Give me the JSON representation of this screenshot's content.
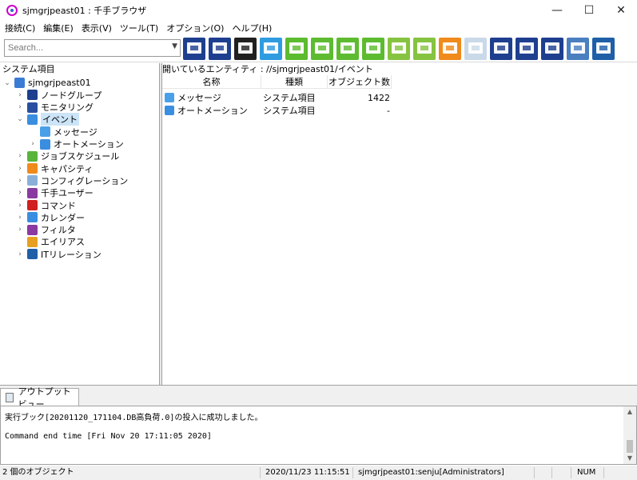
{
  "window": {
    "title": "sjmgrjpeast01 : 千手ブラウザ",
    "minimize": "—",
    "maximize": "☐",
    "close": "✕"
  },
  "menu": [
    "接続(C)",
    "編集(E)",
    "表示(V)",
    "ツール(T)",
    "オプション(O)",
    "ヘルプ(H)"
  ],
  "toolbar": {
    "search_placeholder": "Search...",
    "icons": [
      {
        "name": "connect-tree-icon",
        "color": "#1e3f8f"
      },
      {
        "name": "monitor-window-icon",
        "color": "#1e3f8f"
      },
      {
        "name": "monitor-dark-icon",
        "color": "#202020"
      },
      {
        "name": "message-list-icon",
        "color": "#2f9be0"
      },
      {
        "name": "gear-green-icon",
        "color": "#5dbb2f"
      },
      {
        "name": "gear-green2-icon",
        "color": "#5dbb2f"
      },
      {
        "name": "gear-green3-icon",
        "color": "#5dbb2f"
      },
      {
        "name": "check-monitor-icon",
        "color": "#5dbb2f"
      },
      {
        "name": "bar-chart-icon",
        "color": "#86c340"
      },
      {
        "name": "list-chart-icon",
        "color": "#86c340"
      },
      {
        "name": "orange-chart-icon",
        "color": "#f08a1c"
      },
      {
        "name": "puzzle-icon",
        "color": "#c9d9e8"
      },
      {
        "name": "export-blue-icon",
        "color": "#1e3f8f"
      },
      {
        "name": "import-blue-icon",
        "color": "#1e3f8f"
      },
      {
        "name": "transfer-blue-icon",
        "color": "#1e3f8f"
      },
      {
        "name": "log-icon",
        "color": "#4a7fc0"
      },
      {
        "name": "radar-icon",
        "color": "#1e5fa8"
      }
    ]
  },
  "left_panel": {
    "header": "システム項目",
    "tree": [
      {
        "label": "sjmgrjpeast01",
        "level": 0,
        "twisty": "⌄",
        "icon": "globe-icon",
        "color": "#3a7bd5",
        "selected": false
      },
      {
        "label": "ノードグループ",
        "level": 1,
        "twisty": "›",
        "icon": "node-group-icon",
        "color": "#1e3f8f",
        "selected": false
      },
      {
        "label": "モニタリング",
        "level": 1,
        "twisty": "›",
        "icon": "monitoring-icon",
        "color": "#2a4fa0",
        "selected": false
      },
      {
        "label": "イベント",
        "level": 1,
        "twisty": "⌄",
        "icon": "event-icon",
        "color": "#3a8ee0",
        "selected": true
      },
      {
        "label": "メッセージ",
        "level": 2,
        "twisty": "",
        "icon": "message-icon",
        "color": "#4aa0e8",
        "selected": false
      },
      {
        "label": "オートメーション",
        "level": 2,
        "twisty": "›",
        "icon": "automation-icon",
        "color": "#3a8ee0",
        "selected": false
      },
      {
        "label": "ジョブスケジュール",
        "level": 1,
        "twisty": "›",
        "icon": "job-schedule-icon",
        "color": "#58b43a",
        "selected": false
      },
      {
        "label": "キャパシティ",
        "level": 1,
        "twisty": "›",
        "icon": "capacity-icon",
        "color": "#f08a1c",
        "selected": false
      },
      {
        "label": "コンフィグレーション",
        "level": 1,
        "twisty": "›",
        "icon": "configuration-icon",
        "color": "#8ab0d8",
        "selected": false
      },
      {
        "label": "千手ユーザー",
        "level": 1,
        "twisty": "›",
        "icon": "user-icon",
        "color": "#8a3aa0",
        "selected": false
      },
      {
        "label": "コマンド",
        "level": 1,
        "twisty": "›",
        "icon": "command-icon",
        "color": "#d02020",
        "selected": false
      },
      {
        "label": "カレンダー",
        "level": 1,
        "twisty": "›",
        "icon": "calendar-icon",
        "color": "#3a8ee0",
        "selected": false
      },
      {
        "label": "フィルタ",
        "level": 1,
        "twisty": "›",
        "icon": "filter-icon",
        "color": "#8a3aa0",
        "selected": false
      },
      {
        "label": "エイリアス",
        "level": 1,
        "twisty": "",
        "icon": "alias-icon",
        "color": "#e8a020",
        "selected": false
      },
      {
        "label": "ITリレーション",
        "level": 1,
        "twisty": "›",
        "icon": "it-relation-icon",
        "color": "#1e5fa8",
        "selected": false
      }
    ]
  },
  "right_panel": {
    "header": "開いているエンティティ : //sjmgrjpeast01/イベント",
    "columns": [
      "名称",
      "種類",
      "オブジェクト数"
    ],
    "rows": [
      {
        "name": "メッセージ",
        "type": "システム項目",
        "count": "1422",
        "icon": "message-icon",
        "color": "#4aa0e8"
      },
      {
        "name": "オートメーション",
        "type": "システム項目",
        "count": "-",
        "icon": "automation-icon",
        "color": "#3a8ee0"
      }
    ]
  },
  "output": {
    "tab_label": "アウトプットビュー",
    "lines": [
      "実行ブック[20201120_171104.DB高負荷.0]の投入に成功しました。",
      "",
      "Command end time [Fri Nov 20 17:11:05 2020]"
    ]
  },
  "statusbar": {
    "objects": "2 個のオブジェクト",
    "datetime": "2020/11/23 11:15:51",
    "user": "sjmgrjpeast01:senju[Administrators]",
    "num": "NUM"
  }
}
